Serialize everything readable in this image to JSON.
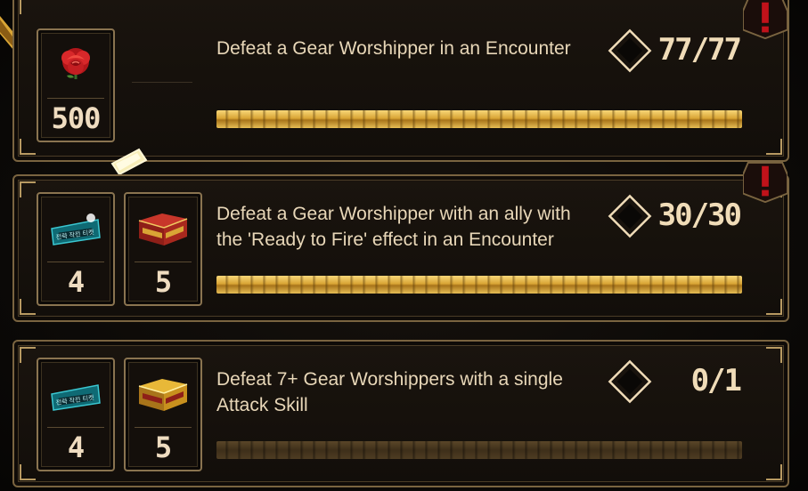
{
  "colors": {
    "gold": "#d9a535",
    "text": "#e8d7b8",
    "frame": "#7a6440",
    "alert": "#c0121a"
  },
  "missions": [
    {
      "description": "Defeat a Gear Worshipper in an Encounter",
      "progress_text": "77/77",
      "progress_fraction": 1.0,
      "rewards": [
        {
          "icon": "rose-icon",
          "count": "500"
        }
      ],
      "alert_icon": "exclamation-icon"
    },
    {
      "description": "Defeat a Gear Worshipper with an ally with the 'Ready to Fire' effect in an Encounter",
      "progress_text": "30/30",
      "progress_fraction": 1.0,
      "rewards": [
        {
          "icon": "ticket-icon",
          "count": "4"
        },
        {
          "icon": "red-chest-icon",
          "count": "5"
        }
      ],
      "alert_icon": "exclamation-icon"
    },
    {
      "description": "Defeat 7+ Gear Worshippers with a single Attack Skill",
      "progress_text": "0/1",
      "progress_fraction": 0.0,
      "rewards": [
        {
          "icon": "ticket-icon",
          "count": "4"
        },
        {
          "icon": "gold-chest-icon",
          "count": "5"
        }
      ]
    }
  ]
}
